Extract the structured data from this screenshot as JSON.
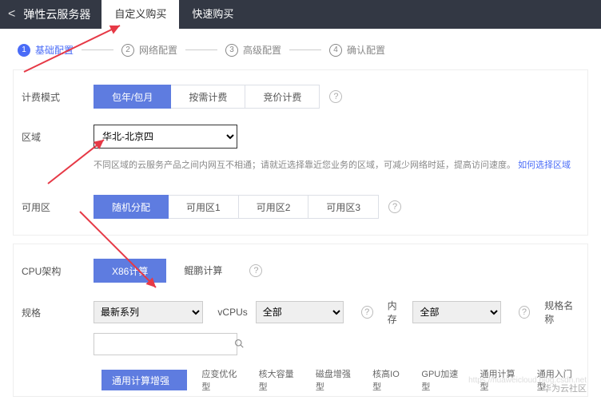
{
  "header": {
    "back": "<",
    "title": "弹性云服务器",
    "tabs": [
      "自定义购买",
      "快速购买"
    ],
    "active_tab": 0
  },
  "steps": [
    {
      "num": "1",
      "label": "基础配置"
    },
    {
      "num": "2",
      "label": "网络配置"
    },
    {
      "num": "3",
      "label": "高级配置"
    },
    {
      "num": "4",
      "label": "确认配置"
    }
  ],
  "billing": {
    "label": "计费模式",
    "options": [
      "包年/包月",
      "按需计费",
      "竞价计费"
    ],
    "help": "?"
  },
  "region": {
    "label": "区域",
    "selected": "华北-北京四",
    "hint_prefix": "不同区域的云服务产品之间内网互不相通；请就近选择靠近您业务的区域，可减少网络时延，提高访问速度。",
    "hint_link": "如何选择区域"
  },
  "az": {
    "label": "可用区",
    "options": [
      "随机分配",
      "可用区1",
      "可用区2",
      "可用区3"
    ],
    "help": "?"
  },
  "cpu": {
    "label": "CPU架构",
    "options": [
      "X86计算",
      "鲲鹏计算"
    ],
    "help": "?"
  },
  "spec": {
    "label": "规格",
    "series_label": "最新系列",
    "vcpu_label": "vCPUs",
    "vcpu_value": "全部",
    "mem_label": "内存",
    "mem_value": "全部",
    "name_label": "规格名称",
    "search_placeholder": ""
  },
  "spec_tabs": [
    "通用计算增强型",
    "应变优化型",
    "核大容量型",
    "磁盘增强型",
    "核高IO型",
    "GPU加速型",
    "通用计算型",
    "通用入门型"
  ],
  "watermark": "华为云社区",
  "watermark2": "https://huaweicloud.blog.csdn.net"
}
